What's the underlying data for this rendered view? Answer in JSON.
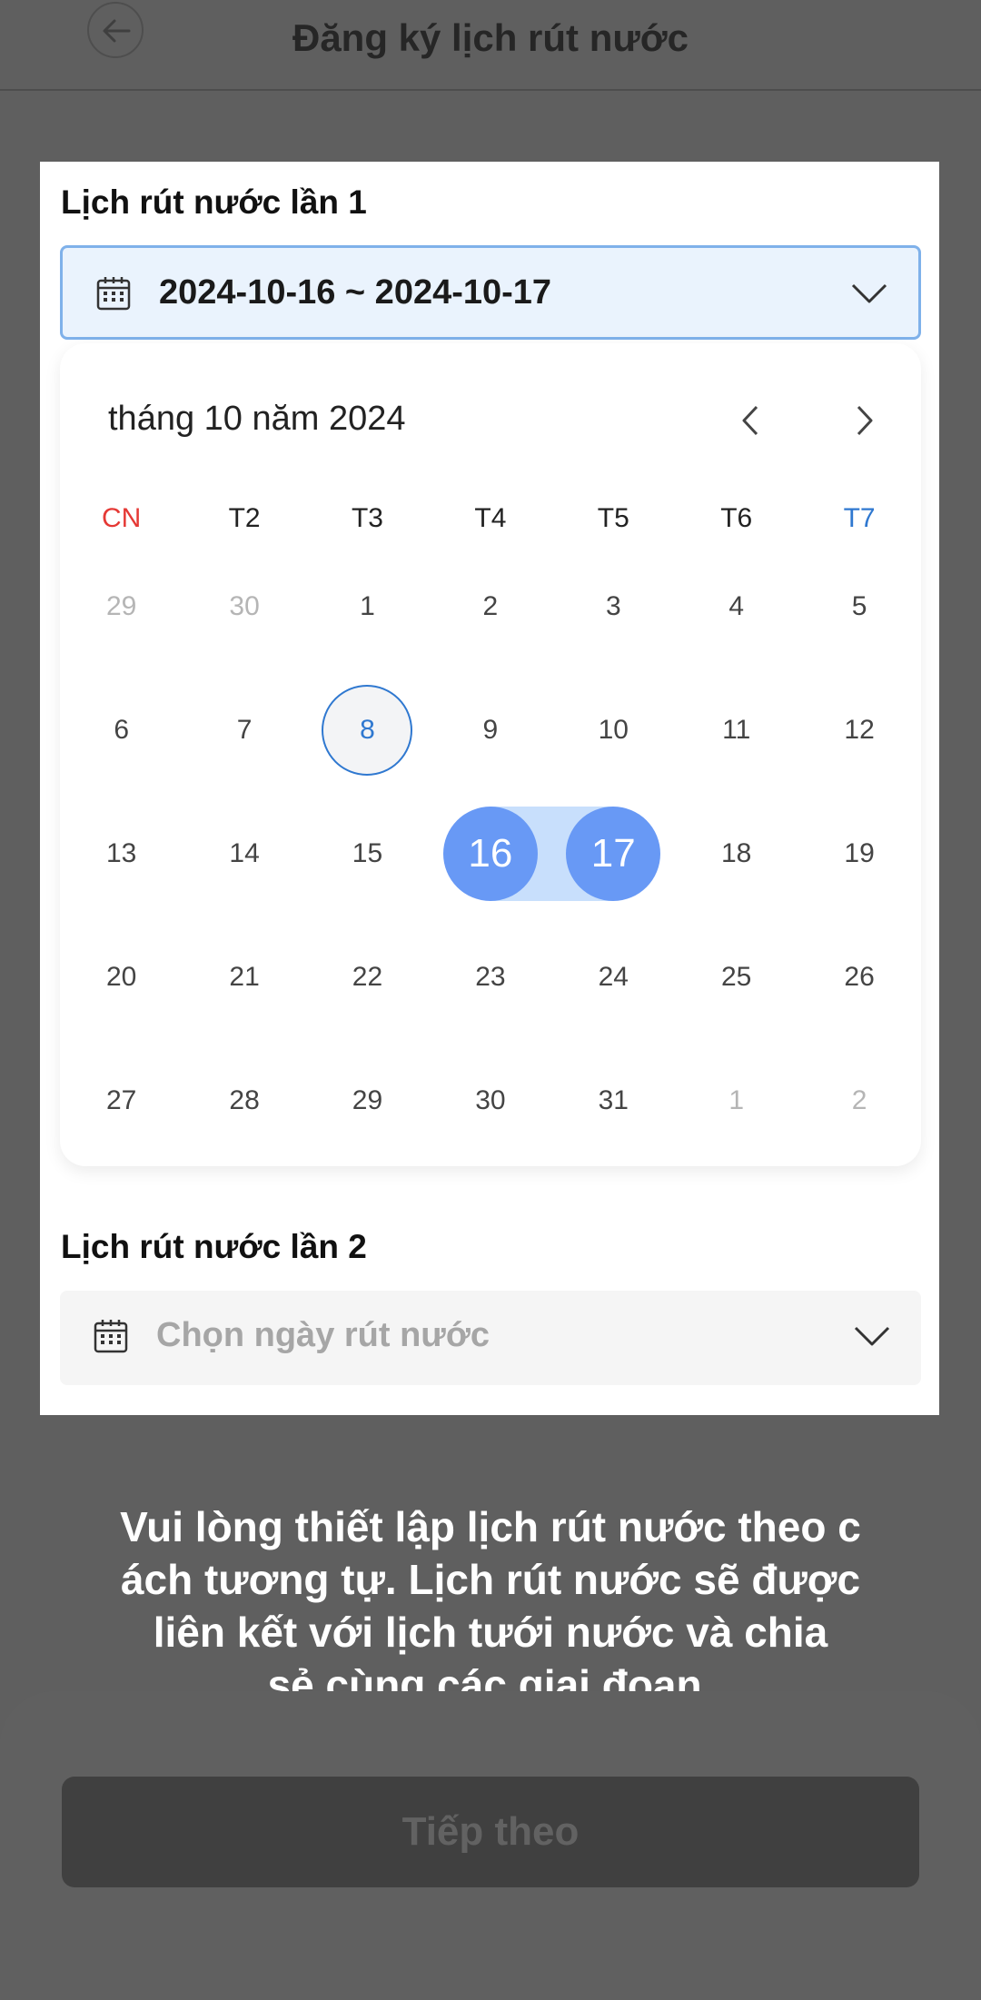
{
  "header": {
    "title": "Đăng ký lịch rút nước"
  },
  "section1": {
    "label": "Lịch rút nước lần 1",
    "value": "2024-10-16 ~ 2024-10-17"
  },
  "calendar": {
    "month_title": "tháng 10 năm 2024",
    "weekdays": [
      "CN",
      "T2",
      "T3",
      "T4",
      "T5",
      "T6",
      "T7"
    ],
    "weeks": [
      [
        "29",
        "30",
        "1",
        "2",
        "3",
        "4",
        "5"
      ],
      [
        "6",
        "7",
        "8",
        "9",
        "10",
        "11",
        "12"
      ],
      [
        "13",
        "14",
        "15",
        "16",
        "17",
        "18",
        "19"
      ],
      [
        "20",
        "21",
        "22",
        "23",
        "24",
        "25",
        "26"
      ],
      [
        "27",
        "28",
        "29",
        "30",
        "31",
        "1",
        "2"
      ]
    ],
    "today": "8",
    "range_start": "16",
    "range_end": "17",
    "colors": {
      "sunday": "#e53935",
      "saturday": "#2f78d0",
      "selected": "#6899f5",
      "range": "#c8dffc"
    }
  },
  "section2": {
    "label": "Lịch rút nước lần 2",
    "placeholder": "Chọn ngày rút nước"
  },
  "message": [
    "Vui lòng thiết lập lịch rút nước theo c",
    "ách tương tự. Lịch rút nước sẽ được",
    "liên kết với lịch tưới nước và chia",
    "sẻ cùng các giai đoạn."
  ],
  "footer": {
    "next_label": "Tiếp theo"
  }
}
